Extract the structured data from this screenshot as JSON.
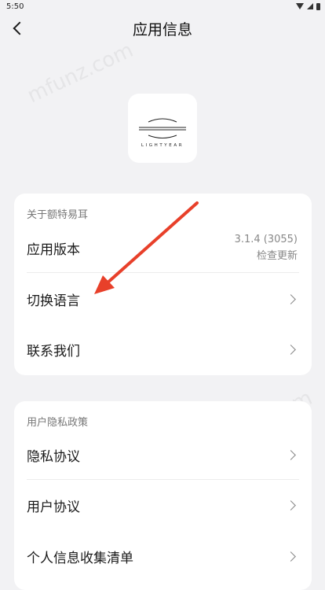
{
  "status_bar": {
    "time": "5:50"
  },
  "header": {
    "title": "应用信息"
  },
  "logo": {
    "text": "LIGHTYEAR"
  },
  "about_section": {
    "title": "关于额特易耳",
    "version_label": "应用版本",
    "version_value": "3.1.4 (3055)",
    "check_update": "检查更新",
    "language_label": "切换语言",
    "contact_label": "联系我们"
  },
  "privacy_section": {
    "title": "用户隐私政策",
    "privacy_label": "隐私协议",
    "user_agreement_label": "用户协议",
    "personal_info_label": "个人信息收集清单"
  },
  "watermark": {
    "text": "mfunz.com"
  },
  "annotation": {
    "arrow_color": "#e8402a"
  }
}
